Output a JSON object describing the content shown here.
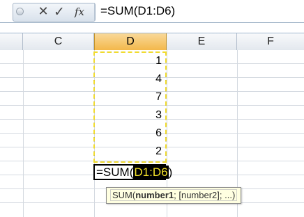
{
  "formula_bar": {
    "cancel_icon": "x-icon",
    "enter_icon": "check-icon",
    "insert_function_label": "fx",
    "formula": "=SUM(D1:D6)"
  },
  "columns": [
    {
      "letter": "C",
      "active": false
    },
    {
      "letter": "D",
      "active": true
    },
    {
      "letter": "E",
      "active": false
    },
    {
      "letter": "F",
      "active": false
    }
  ],
  "cells_d": [
    "1",
    "4",
    "7",
    "3",
    "6",
    "2"
  ],
  "edit_cell": {
    "prefix": "=SUM(",
    "range": "D1:D6",
    "suffix": ")"
  },
  "tooltip": {
    "func": "SUM(",
    "arg1": "number1",
    "rest": "; [number2]; ...)"
  },
  "colors": {
    "active_header": "#f3b84b",
    "range_highlight": "#f2dc2c",
    "tooltip_bg": "#ffffe1"
  }
}
